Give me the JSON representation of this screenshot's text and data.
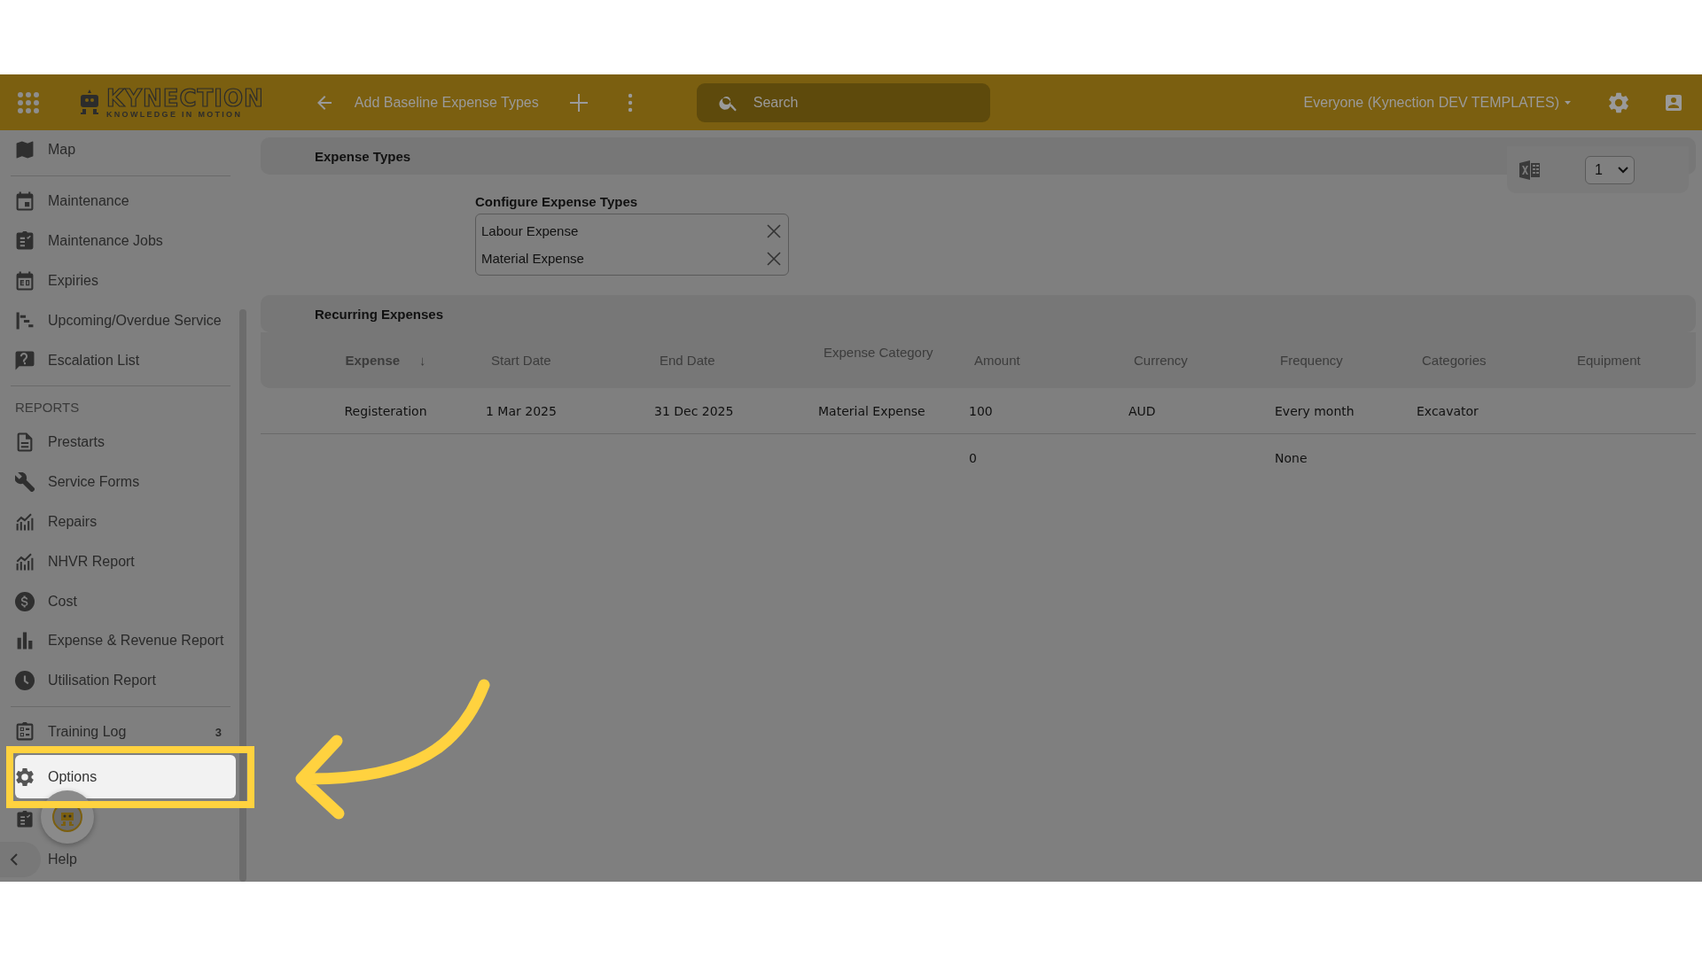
{
  "topbar": {
    "logo": {
      "name": "KYNECTION",
      "tagline": "KNOWLEDGE IN MOTION"
    },
    "page_title": "Add Baseline Expense Types",
    "search": {
      "placeholder": "Search"
    },
    "organisation": "Everyone (Kynection DEV TEMPLATES)"
  },
  "sidebar": {
    "sections": [
      {
        "items": [
          {
            "label": "Map",
            "selected": false
          }
        ]
      },
      {
        "items": [
          {
            "label": "Maintenance",
            "selected": false
          },
          {
            "label": "Maintenance Jobs",
            "selected": false
          },
          {
            "label": "Expiries",
            "selected": false
          },
          {
            "label": "Upcoming/Overdue Service",
            "selected": false
          },
          {
            "label": "Escalation List",
            "selected": false
          }
        ]
      },
      {
        "heading": "REPORTS",
        "items": [
          {
            "label": "Prestarts",
            "selected": false
          },
          {
            "label": "Service Forms",
            "selected": false
          },
          {
            "label": "Repairs",
            "selected": false
          },
          {
            "label": "NHVR Report",
            "selected": false
          },
          {
            "label": "Cost",
            "selected": false
          },
          {
            "label": "Expense & Revenue Report",
            "selected": false
          },
          {
            "label": "Utilisation Report",
            "selected": false
          }
        ]
      },
      {
        "items": [
          {
            "label": "Training Log",
            "selected": false,
            "badge": "3"
          },
          {
            "label": "Options",
            "selected": true
          }
        ]
      }
    ],
    "help": "Help"
  },
  "expense_types": {
    "title": "Expense Types",
    "page_select": "1",
    "configure_label": "Configure Expense Types",
    "types": [
      "Labour Expense",
      "Material Expense"
    ]
  },
  "recurring_expenses": {
    "title": "Recurring Expenses",
    "columns": [
      {
        "label": "Expense",
        "sort": "↓"
      },
      {
        "label": "Start Date"
      },
      {
        "label": "End Date"
      },
      {
        "label": "Expense Category"
      },
      {
        "label": "Amount"
      },
      {
        "label": "Currency"
      },
      {
        "label": "Frequency"
      },
      {
        "label": "Categories"
      },
      {
        "label": "Equipment"
      }
    ],
    "rows": [
      {
        "cells": [
          "Registeration",
          "1 Mar 2025",
          "31 Dec 2025",
          "Material Expense",
          "100",
          "AUD",
          "Every month",
          "Excavator",
          null
        ]
      },
      {
        "cells": [
          null,
          null,
          null,
          null,
          "0",
          null,
          "None",
          null,
          null
        ]
      }
    ]
  }
}
